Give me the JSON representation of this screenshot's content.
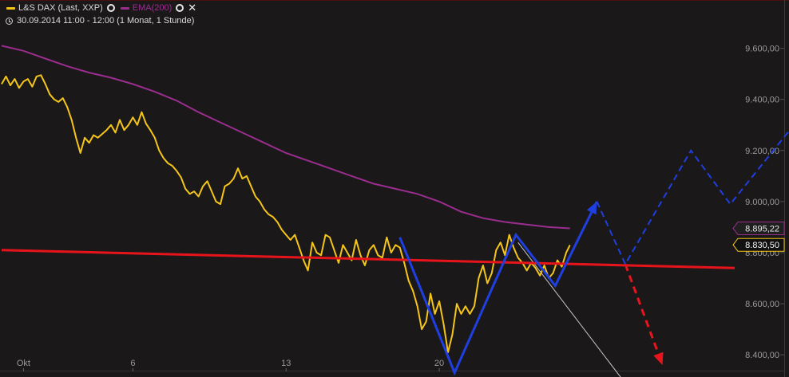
{
  "legend": {
    "series_main_label": "L&S DAX (Last, XXP)",
    "series_ema_label": "EMA(200)",
    "range_label": "30.09.2014 11:00 - 12:00 (1 Monat, 1 Stunde)",
    "icons": {
      "settings": "circle-settings-icon",
      "close": "close-x-icon",
      "clock": "clock-icon"
    }
  },
  "colors": {
    "background": "#1a1819",
    "price": "#f5c518",
    "ema": "#9b2d8f",
    "support": "#e8141c",
    "pattern": "#1f3fe0",
    "down_scenario": "#e8141c",
    "up_scenario": "#1f3fe0",
    "thin_trendline": "#c8c8c8"
  },
  "chart_data": {
    "type": "line",
    "title": "",
    "xlabel": "",
    "ylabel": "",
    "x_tick_labels": [
      {
        "label": "Okt",
        "day": 1
      },
      {
        "label": "6",
        "day": 6
      },
      {
        "label": "13",
        "day": 13
      },
      {
        "label": "20",
        "day": 20
      }
    ],
    "xlim_days": [
      0.0,
      33.5
    ],
    "ylim": [
      8310,
      9680
    ],
    "y_tick_values": [
      8400,
      8600,
      8800,
      9000,
      9200,
      9400,
      9600
    ],
    "y_tick_labels": [
      "8.400,00",
      "8.600,00",
      "8.800,00",
      "9.000,00",
      "9.200,00",
      "9.400,00",
      "9.600,00"
    ],
    "legend_position": "top-left",
    "grid": false,
    "last_values": [
      {
        "label": "8.895,22",
        "value": 8895.22,
        "series": "EMA(200)"
      },
      {
        "label": "8.830,50",
        "value": 8830.5,
        "series": "L&S DAX (Last, XXP)"
      }
    ],
    "series": [
      {
        "name": "L&S DAX (Last, XXP)",
        "points": [
          [
            0.0,
            9460
          ],
          [
            0.2,
            9490
          ],
          [
            0.4,
            9455
          ],
          [
            0.6,
            9480
          ],
          [
            0.8,
            9445
          ],
          [
            1.0,
            9470
          ],
          [
            1.2,
            9480
          ],
          [
            1.4,
            9450
          ],
          [
            1.6,
            9490
          ],
          [
            1.8,
            9495
          ],
          [
            2.0,
            9460
          ],
          [
            2.2,
            9420
          ],
          [
            2.4,
            9400
          ],
          [
            2.6,
            9390
          ],
          [
            2.8,
            9405
          ],
          [
            3.0,
            9370
          ],
          [
            3.2,
            9320
          ],
          [
            3.4,
            9250
          ],
          [
            3.6,
            9190
          ],
          [
            3.8,
            9250
          ],
          [
            4.0,
            9230
          ],
          [
            4.2,
            9260
          ],
          [
            4.4,
            9250
          ],
          [
            4.6,
            9265
          ],
          [
            4.8,
            9280
          ],
          [
            5.0,
            9300
          ],
          [
            5.2,
            9270
          ],
          [
            5.4,
            9320
          ],
          [
            5.6,
            9280
          ],
          [
            5.8,
            9300
          ],
          [
            6.0,
            9330
          ],
          [
            6.2,
            9300
          ],
          [
            6.4,
            9350
          ],
          [
            6.6,
            9305
          ],
          [
            6.8,
            9280
          ],
          [
            7.0,
            9250
          ],
          [
            7.2,
            9200
          ],
          [
            7.4,
            9170
          ],
          [
            7.6,
            9150
          ],
          [
            7.8,
            9140
          ],
          [
            8.0,
            9120
          ],
          [
            8.2,
            9095
          ],
          [
            8.4,
            9050
          ],
          [
            8.6,
            9030
          ],
          [
            8.8,
            9040
          ],
          [
            9.0,
            9020
          ],
          [
            9.2,
            9060
          ],
          [
            9.4,
            9080
          ],
          [
            9.6,
            9040
          ],
          [
            9.8,
            9000
          ],
          [
            10.0,
            8990
          ],
          [
            10.2,
            9060
          ],
          [
            10.4,
            9070
          ],
          [
            10.6,
            9090
          ],
          [
            10.8,
            9130
          ],
          [
            11.0,
            9090
          ],
          [
            11.2,
            9100
          ],
          [
            11.4,
            9060
          ],
          [
            11.6,
            9020
          ],
          [
            11.8,
            9000
          ],
          [
            12.0,
            8970
          ],
          [
            12.2,
            8950
          ],
          [
            12.4,
            8940
          ],
          [
            12.6,
            8920
          ],
          [
            12.8,
            8890
          ],
          [
            13.0,
            8870
          ],
          [
            13.2,
            8850
          ],
          [
            13.4,
            8870
          ],
          [
            13.6,
            8820
          ],
          [
            13.8,
            8770
          ],
          [
            14.0,
            8730
          ],
          [
            14.2,
            8840
          ],
          [
            14.4,
            8800
          ],
          [
            14.6,
            8790
          ],
          [
            14.8,
            8870
          ],
          [
            15.0,
            8860
          ],
          [
            15.2,
            8810
          ],
          [
            15.4,
            8760
          ],
          [
            15.6,
            8830
          ],
          [
            15.8,
            8800
          ],
          [
            16.0,
            8770
          ],
          [
            16.2,
            8850
          ],
          [
            16.4,
            8790
          ],
          [
            16.6,
            8750
          ],
          [
            16.8,
            8810
          ],
          [
            17.0,
            8830
          ],
          [
            17.2,
            8790
          ],
          [
            17.4,
            8780
          ],
          [
            17.6,
            8860
          ],
          [
            17.8,
            8800
          ],
          [
            18.0,
            8830
          ],
          [
            18.2,
            8820
          ],
          [
            18.4,
            8760
          ],
          [
            18.6,
            8690
          ],
          [
            18.8,
            8650
          ],
          [
            19.0,
            8590
          ],
          [
            19.2,
            8500
          ],
          [
            19.4,
            8530
          ],
          [
            19.6,
            8640
          ],
          [
            19.8,
            8560
          ],
          [
            20.0,
            8610
          ],
          [
            20.2,
            8520
          ],
          [
            20.4,
            8410
          ],
          [
            20.6,
            8480
          ],
          [
            20.8,
            8600
          ],
          [
            21.0,
            8560
          ],
          [
            21.2,
            8590
          ],
          [
            21.4,
            8560
          ],
          [
            21.6,
            8590
          ],
          [
            21.8,
            8700
          ],
          [
            22.0,
            8750
          ],
          [
            22.2,
            8680
          ],
          [
            22.4,
            8720
          ],
          [
            22.6,
            8810
          ],
          [
            22.8,
            8840
          ],
          [
            23.0,
            8790
          ],
          [
            23.2,
            8870
          ],
          [
            23.4,
            8820
          ],
          [
            23.6,
            8780
          ],
          [
            23.8,
            8760
          ],
          [
            24.0,
            8730
          ],
          [
            24.2,
            8760
          ],
          [
            24.4,
            8740
          ],
          [
            24.6,
            8710
          ],
          [
            24.8,
            8750
          ],
          [
            25.0,
            8700
          ],
          [
            25.2,
            8720
          ],
          [
            25.4,
            8770
          ],
          [
            25.6,
            8745
          ],
          [
            25.8,
            8800
          ],
          [
            25.97,
            8830
          ]
        ]
      },
      {
        "name": "EMA(200)",
        "points": [
          [
            0.0,
            9610
          ],
          [
            1.0,
            9590
          ],
          [
            2.0,
            9560
          ],
          [
            3.0,
            9530
          ],
          [
            4.0,
            9505
          ],
          [
            5.0,
            9485
          ],
          [
            6.0,
            9460
          ],
          [
            7.0,
            9430
          ],
          [
            8.0,
            9395
          ],
          [
            9.0,
            9350
          ],
          [
            10.0,
            9310
          ],
          [
            11.0,
            9270
          ],
          [
            12.0,
            9230
          ],
          [
            13.0,
            9190
          ],
          [
            14.0,
            9160
          ],
          [
            15.0,
            9130
          ],
          [
            16.0,
            9100
          ],
          [
            17.0,
            9070
          ],
          [
            18.0,
            9050
          ],
          [
            19.0,
            9030
          ],
          [
            20.0,
            9000
          ],
          [
            21.0,
            8960
          ],
          [
            22.0,
            8935
          ],
          [
            23.0,
            8920
          ],
          [
            24.0,
            8910
          ],
          [
            25.0,
            8900
          ],
          [
            25.97,
            8895
          ]
        ]
      }
    ],
    "annotations": {
      "support_line": [
        [
          0.0,
          8810
        ],
        [
          33.5,
          8740
        ]
      ],
      "w_pattern": [
        [
          18.2,
          8860
        ],
        [
          20.7,
          8330
        ],
        [
          23.5,
          8870
        ],
        [
          25.3,
          8670
        ],
        [
          27.2,
          9000
        ]
      ],
      "bullish_scenario": [
        [
          27.2,
          9000
        ],
        [
          28.5,
          8755
        ],
        [
          31.5,
          9200
        ],
        [
          33.3,
          8990
        ],
        [
          37.7,
          9460
        ]
      ],
      "bearish_scenario": [
        [
          28.5,
          8755
        ],
        [
          30.2,
          8360
        ]
      ],
      "thin_trendline": [
        [
          23.6,
          8840
        ],
        [
          28.4,
          8300
        ]
      ]
    }
  }
}
